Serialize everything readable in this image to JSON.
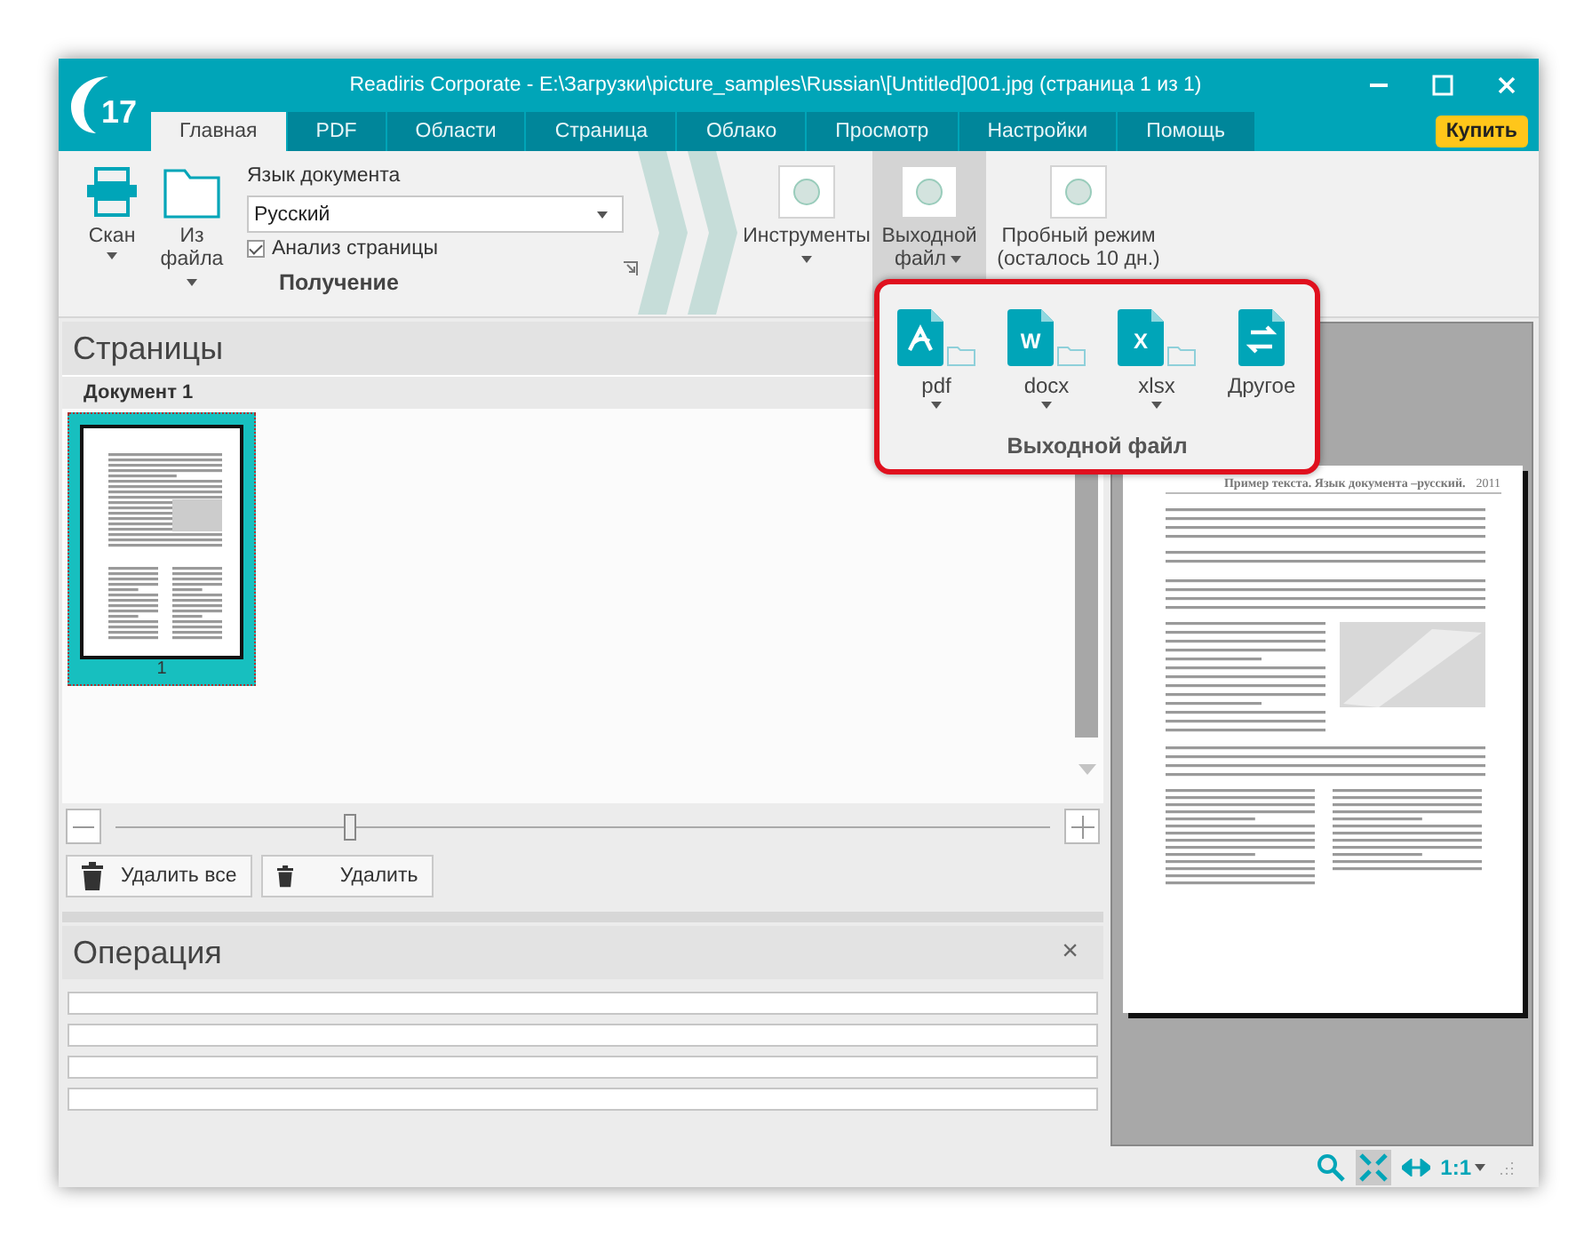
{
  "window": {
    "logo": "17",
    "title": "Readiris Corporate - E:\\Загрузки\\picture_samples\\Russian\\[Untitled]001.jpg (страница 1 из 1)",
    "buy_button": "Купить"
  },
  "tabs": [
    {
      "label": "Главная",
      "selected": true
    },
    {
      "label": "PDF",
      "selected": false
    },
    {
      "label": "Области",
      "selected": false
    },
    {
      "label": "Страница",
      "selected": false
    },
    {
      "label": "Облако",
      "selected": false
    },
    {
      "label": "Просмотр",
      "selected": false
    },
    {
      "label": "Настройки",
      "selected": false
    },
    {
      "label": "Помощь",
      "selected": false
    }
  ],
  "ribbon": {
    "scan": "Скан",
    "from_file": "Из файла",
    "language": {
      "label": "Язык документа",
      "value": "Русский"
    },
    "page_analysis": {
      "label": "Анализ страницы",
      "checked": true
    },
    "group_label": "Получение",
    "buttons": [
      {
        "label": "Инструменты",
        "selected": false
      },
      {
        "label": "Выходной файл",
        "selected": true
      },
      {
        "label": "Пробный режим (осталось 10 дн.)",
        "selected": false
      }
    ]
  },
  "output_popup": {
    "title": "Выходной файл",
    "formats": [
      {
        "kind": "pdf",
        "label": "pdf"
      },
      {
        "kind": "letter",
        "glyph": "W",
        "label": "docx"
      },
      {
        "kind": "letter",
        "glyph": "X",
        "label": "xlsx"
      },
      {
        "kind": "other",
        "label": "Другое"
      }
    ]
  },
  "pages": {
    "title": "Страницы",
    "document": "Документ 1",
    "thumbnails": [
      {
        "number": "1",
        "selected": true
      }
    ],
    "zoom": {
      "level": 0.25
    },
    "buttons": [
      "Удалить все",
      "Удалить"
    ]
  },
  "operation": {
    "title": "Операция",
    "close": "×",
    "progress": [
      {
        "level": 0
      },
      {
        "level": 0
      },
      {
        "level": 0
      },
      {
        "level": 0
      }
    ]
  },
  "preview": {
    "heading": "Пример текста. Язык документа –русский.",
    "year": "2011"
  },
  "status_bar": {
    "ratio": "1:1"
  }
}
